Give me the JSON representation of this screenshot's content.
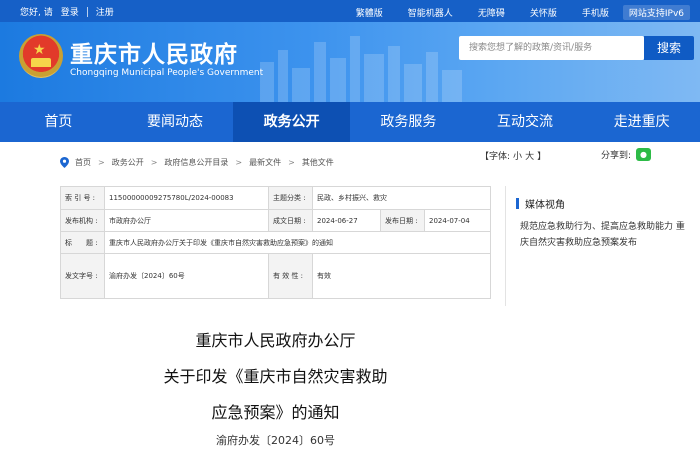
{
  "topbar": {
    "greeting": "您好, 请",
    "login": "登录",
    "register": "注册",
    "links": [
      "繁體版",
      "智能机器人",
      "无障碍",
      "关怀版",
      "手机版"
    ],
    "ipv6": "网站支持IPv6"
  },
  "header": {
    "site_title": "重庆市人民政府",
    "site_subtitle": "Chongqing Municipal People's Government",
    "search_placeholder": "搜索您想了解的政策/资讯/服务",
    "search_button": "搜索"
  },
  "nav": {
    "items": [
      "首页",
      "要闻动态",
      "政务公开",
      "政务服务",
      "互动交流",
      "走进重庆"
    ],
    "active_index": 2
  },
  "breadcrumb": {
    "items": [
      "首页",
      "政务公开",
      "政府信息公开目录",
      "最新文件",
      "其他文件"
    ],
    "separator": ">"
  },
  "font_size": {
    "label": "【字体:",
    "small": "小",
    "large": "大",
    "close": "】"
  },
  "share": {
    "label": "分享到:",
    "icon": "wechat-icon"
  },
  "meta": {
    "index_label": "索 引 号 :",
    "index_value": "11500000009275780L/2024-00083",
    "topic_label": "主题分类 :",
    "topic_value": "民政、乡村振兴、救灾",
    "issuer_label": "发布机构 :",
    "issuer_value": "市政府办公厅",
    "created_label": "成文日期 :",
    "created_value": "2024-06-27",
    "published_label": "发布日期 :",
    "published_value": "2024-07-04",
    "title_label": "标　　题 :",
    "title_value": "重庆市人民政府办公厅关于印发《重庆市自然灾害救助应急预案》的通知",
    "docno_label": "发文字号 :",
    "docno_value": "渝府办发〔2024〕60号",
    "validity_label": "有 效 性 :",
    "validity_value": "有效"
  },
  "sidebar": {
    "title": "媒体视角",
    "link": "规范应急救助行为、提高应急救助能力 重庆自然灾害救助应急预案发布"
  },
  "document": {
    "title_line1": "重庆市人民政府办公厅",
    "title_line2": "关于印发《重庆市自然灾害救助",
    "title_line3": "应急预案》的通知",
    "number": "渝府办发〔2024〕60号"
  },
  "colors": {
    "brand_blue": "#1660c7",
    "nav_blue": "#1b66d1",
    "nav_active": "#0d50b3",
    "wechat_green": "#2dbb47"
  }
}
